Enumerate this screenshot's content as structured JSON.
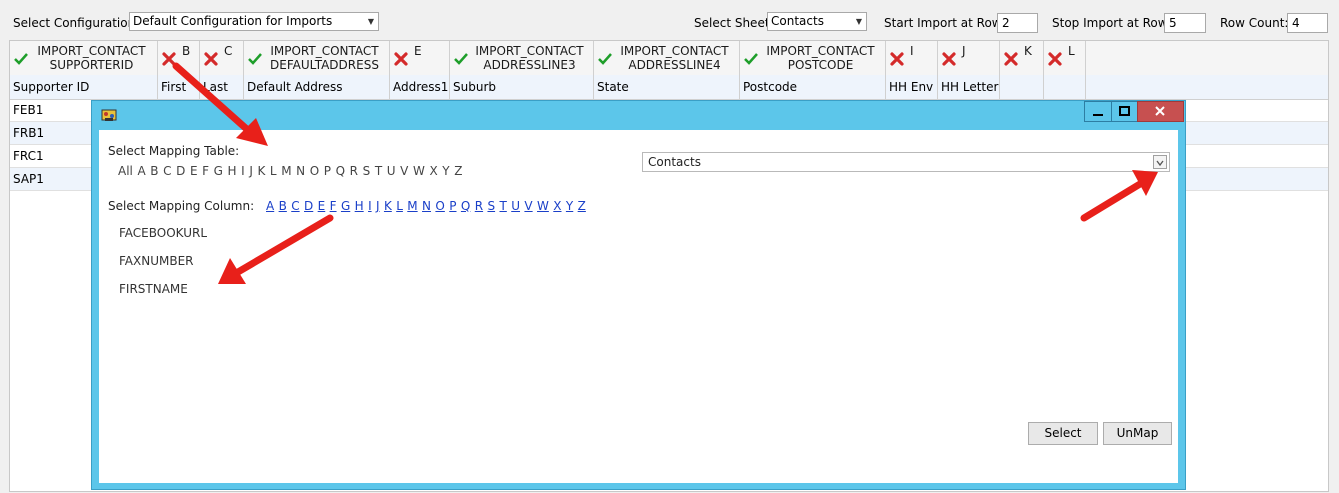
{
  "toolbar": {
    "config_label": "Select Configuration",
    "config_value": "Default Configuration for Imports",
    "sheet_label": "Select Sheet",
    "sheet_value": "Contacts",
    "start_label": "Start Import at Row:",
    "start_value": "2",
    "stop_label": "Stop Import at Row:",
    "stop_value": "5",
    "count_label": "Row Count:",
    "count_value": "4"
  },
  "columns": [
    {
      "status": "check",
      "line1": "IMPORT_CONTACT",
      "line2": "SUPPORTERID",
      "sub": "Supporter ID"
    },
    {
      "status": "x",
      "letter": "B",
      "sub": "First"
    },
    {
      "status": "x",
      "letter": "C",
      "sub": "Last"
    },
    {
      "status": "check",
      "line1": "IMPORT_CONTACT",
      "line2": "DEFAULTADDRESS",
      "sub": "Default Address"
    },
    {
      "status": "x",
      "letter": "E",
      "sub": "Address1"
    },
    {
      "status": "check",
      "line1": "IMPORT_CONTACT",
      "line2": "ADDRESSLINE3",
      "sub": "Suburb"
    },
    {
      "status": "check",
      "line1": "IMPORT_CONTACT",
      "line2": "ADDRESSLINE4",
      "sub": "State"
    },
    {
      "status": "check",
      "line1": "IMPORT_CONTACT",
      "line2": "POSTCODE",
      "sub": "Postcode"
    },
    {
      "status": "x",
      "letter": "I",
      "sub": "HH Env"
    },
    {
      "status": "x",
      "letter": "J",
      "sub": "HH Letter"
    },
    {
      "status": "x",
      "letter": "K",
      "sub": ""
    },
    {
      "status": "x",
      "letter": "L",
      "sub": ""
    }
  ],
  "rows": [
    "FEB1",
    "FRB1",
    "FRC1",
    "SAP1"
  ],
  "dialog": {
    "table_label": "Select Mapping Table:",
    "table_letters": [
      "All",
      "A",
      "B",
      "C",
      "D",
      "E",
      "F",
      "G",
      "H",
      "I",
      "J",
      "K",
      "L",
      "M",
      "N",
      "O",
      "P",
      "Q",
      "R",
      "S",
      "T",
      "U",
      "V",
      "W",
      "X",
      "Y",
      "Z"
    ],
    "table_value": "Contacts",
    "column_label": "Select Mapping Column:",
    "column_letters": [
      "A",
      "B",
      "C",
      "D",
      "E",
      "F",
      "G",
      "H",
      "I",
      "J",
      "K",
      "L",
      "M",
      "N",
      "O",
      "P",
      "Q",
      "R",
      "S",
      "T",
      "U",
      "V",
      "W",
      "X",
      "Y",
      "Z"
    ],
    "column_items": [
      "FACEBOOKURL",
      "FAXNUMBER",
      "FIRSTNAME"
    ],
    "select_button": "Select",
    "unmap_button": "UnMap"
  },
  "colors": {
    "check": "#1e9e2a",
    "x": "#d42a2a",
    "dialog": "#5cc6ea",
    "close": "#c75050",
    "link": "#1a3fc8",
    "arrow": "#e8201a"
  },
  "icons": {
    "check": "check-icon",
    "x": "x-icon",
    "app": "app-icon",
    "minimize": "minimize-icon",
    "maximize": "maximize-icon",
    "close": "close-icon",
    "dropdown": "chevron-down-icon"
  }
}
